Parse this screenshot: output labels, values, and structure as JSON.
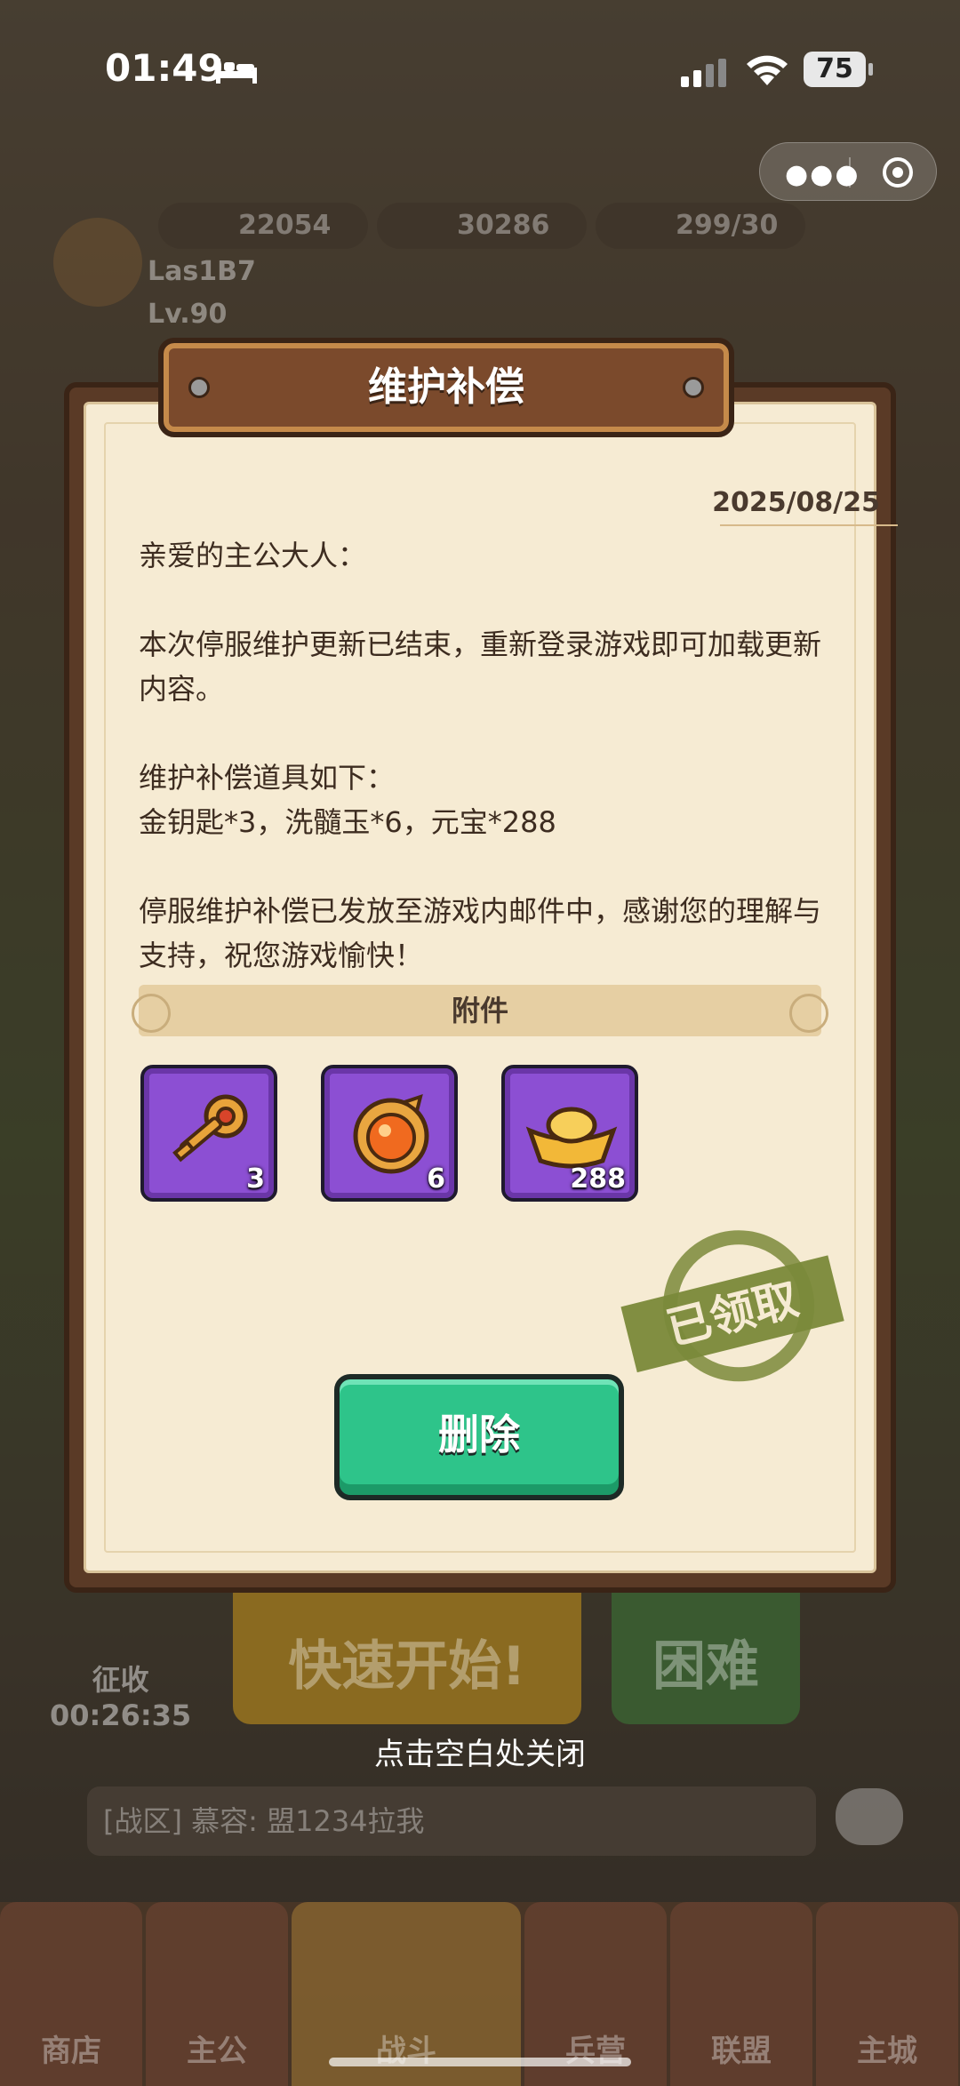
{
  "status_bar": {
    "time": "01:49",
    "battery": "75"
  },
  "background": {
    "resources": [
      "22054",
      "30286",
      "299/30"
    ],
    "player_name": "Las1B7",
    "player_level": "Lv.90",
    "quick_start": "快速开始!",
    "difficulty": "困难",
    "collect_label": "征收",
    "collect_timer": "00:26:35",
    "chat_message": "[战区] 慕容: 盟1234拉我",
    "nav": [
      "商店",
      "主公",
      "战斗",
      "兵营",
      "联盟",
      "主城"
    ]
  },
  "dialog": {
    "title": "维护补偿",
    "date": "2025/08/25",
    "greeting": "亲爱的主公大人：",
    "paragraph1": "本次停服维护更新已结束，重新登录游戏即可加载更新内容。",
    "paragraph2_line1": "维护补偿道具如下：",
    "paragraph2_line2": "金钥匙*3，洗髓玉*6，元宝*288",
    "paragraph3": "停服维护补偿已发放至游戏内邮件中，感谢您的理解与支持，祝您游戏愉快！",
    "attachments_label": "附件",
    "items": [
      {
        "icon": "golden-key-icon",
        "count": "3"
      },
      {
        "icon": "marrow-jade-icon",
        "count": "6"
      },
      {
        "icon": "ingot-icon",
        "count": "288"
      }
    ],
    "stamp": "已领取",
    "delete_label": "删除"
  },
  "close_hint": "点击空白处关闭",
  "colors": {
    "paper": "#f6ebd3",
    "frame": "#5a3a26",
    "delete_button": "#2ec48a",
    "item_bg": "#8c4fd3",
    "stamp": "#7b8a3a"
  }
}
